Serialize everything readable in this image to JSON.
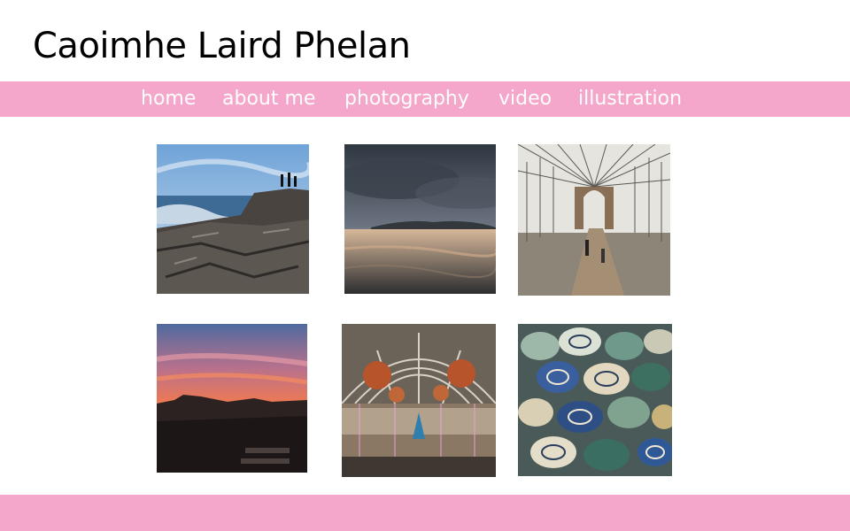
{
  "site": {
    "title": "Caoimhe Laird Phelan"
  },
  "nav": {
    "items": [
      {
        "label": "home"
      },
      {
        "label": "about me"
      },
      {
        "label": "photography"
      },
      {
        "label": "video"
      },
      {
        "label": "illustration"
      }
    ]
  },
  "colors": {
    "accent": "#f4a6cb",
    "nav_text": "#ffffff",
    "title_text": "#000000"
  },
  "gallery": {
    "thumbnails": [
      {
        "subject": "people on coastal basalt rocks at the sea"
      },
      {
        "subject": "cloudy sunset over a beach and distant hills"
      },
      {
        "subject": "suspension bridge walkway with cables and tower"
      },
      {
        "subject": "orange and pink sunset over rooftops"
      },
      {
        "subject": "glass-roofed shopping centre with hanging lanterns"
      },
      {
        "subject": "stacked painted ceramic pottery and bowls"
      }
    ]
  }
}
